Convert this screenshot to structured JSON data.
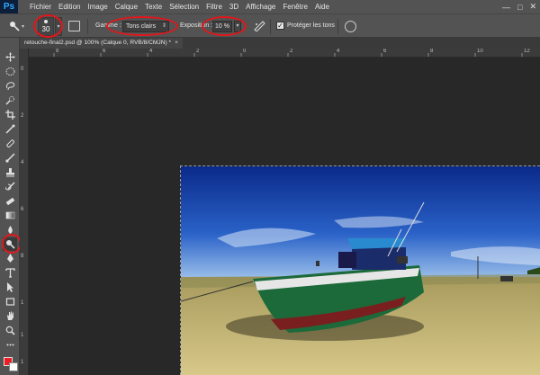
{
  "app": {
    "logo_text": "Ps",
    "menu": [
      "Fichier",
      "Edition",
      "Image",
      "Calque",
      "Texte",
      "Sélection",
      "Filtre",
      "3D",
      "Affichage",
      "Fenêtre",
      "Aide"
    ],
    "window_controls": {
      "minimize": "—",
      "maximize": "□",
      "close": "✕"
    }
  },
  "options_bar": {
    "tool_icon": "burn-tool-icon",
    "brush_size": "30",
    "range_label": "Gamme :",
    "range_value": "Tons clairs",
    "exposure_label": "Exposition :",
    "exposure_value": "10 %",
    "protect_tones_checked": true,
    "protect_tones_label": "Protéger les tons",
    "highlight_color": "#e2161b"
  },
  "document": {
    "tab_title": "retouche-final2.psd @ 100% (Calque 0, RVB/8/CMJN) *",
    "close_glyph": "×"
  },
  "rulers": {
    "top_labels": [
      "8",
      "6",
      "4",
      "2",
      "0",
      "2",
      "4",
      "6",
      "8",
      "10",
      "12"
    ],
    "left_labels": [
      "0",
      "2",
      "4",
      "6",
      "8",
      "1",
      "1",
      "1"
    ]
  },
  "toolbox": {
    "tools": [
      "move-tool-icon",
      "marquee-tool-icon",
      "lasso-tool-icon",
      "quick-select-tool-icon",
      "crop-tool-icon",
      "eyedropper-tool-icon",
      "healing-brush-icon",
      "brush-tool-icon",
      "clone-stamp-icon",
      "history-brush-icon",
      "eraser-tool-icon",
      "gradient-tool-icon",
      "blur-tool-icon",
      "burn-tool-icon",
      "pen-tool-icon",
      "type-tool-icon",
      "path-select-icon",
      "rectangle-tool-icon",
      "hand-tool-icon",
      "zoom-tool-icon"
    ],
    "foreground_color": "#ee1c24",
    "background_color": "#ffffff"
  }
}
